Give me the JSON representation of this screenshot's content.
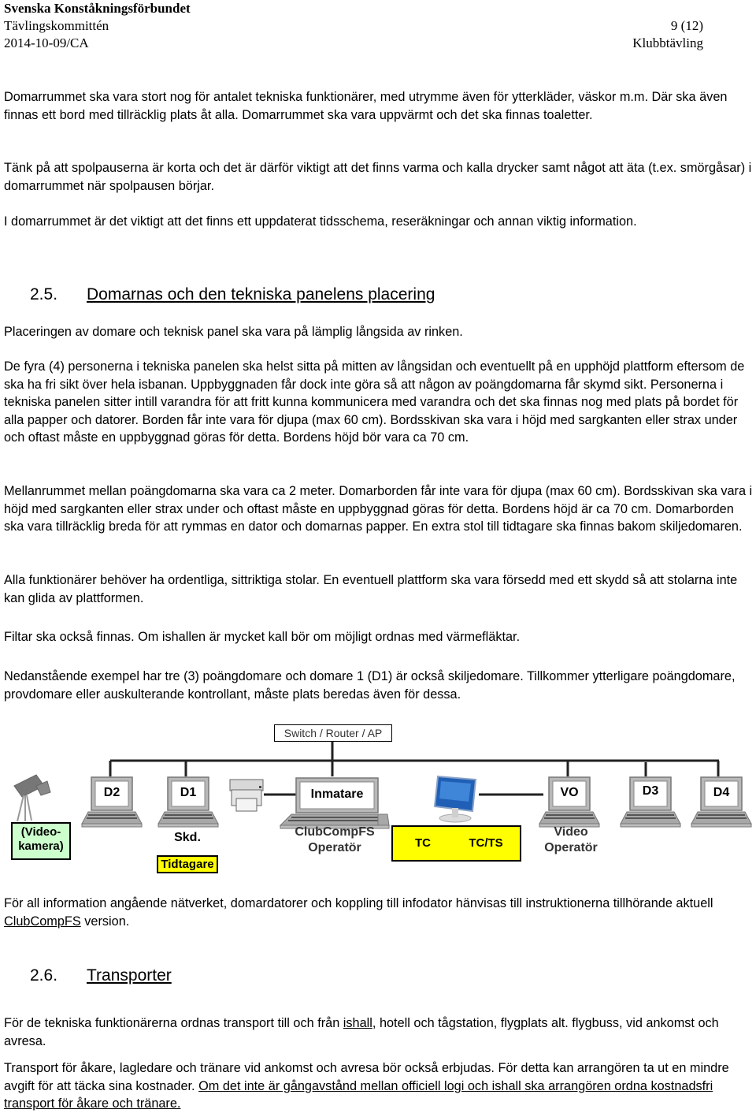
{
  "header": {
    "organization": "Svenska Konståkningsförbundet",
    "committee": "Tävlingskommittén",
    "page": "9 (12)",
    "date_ref": "2014-10-09/CA",
    "doc_type": "Klubbtävling"
  },
  "paragraphs": {
    "p1": "Domarrummet ska vara stort nog för antalet tekniska funktionärer, med utrymme även för ytterkläder, väskor m.m. Där ska även finnas ett bord med tillräcklig plats åt alla. Domarrummet ska vara uppvärmt och det ska finnas toaletter.",
    "p2": "Tänk på att spolpauserna är korta och det är därför viktigt att det finns varma och kalla drycker samt något att äta (t.ex. smörgåsar) i domarrummet när spolpausen börjar.",
    "p3": "I domarrummet är det viktigt att det finns ett uppdaterat tidsschema, reseräkningar och annan viktig information."
  },
  "section_2_5": {
    "number": "2.5.",
    "title": "Domarnas och den tekniska panelens placering",
    "p1": "Placeringen av domare och teknisk panel ska vara på lämplig långsida av rinken.",
    "p2": "De fyra (4) personerna i tekniska panelen ska helst sitta på mitten av långsidan och eventuellt på en upphöjd plattform eftersom de ska ha fri sikt över hela isbanan. Uppbyggnaden får dock inte göra så att någon av poängdomarna får skymd sikt. Personerna i tekniska panelen sitter intill varandra för att fritt kunna kommunicera med varandra och det ska finnas nog med plats på bordet för alla papper och datorer. Borden får inte vara för djupa (max 60 cm). Bordsskivan ska vara i höjd med sargkanten eller strax under och oftast måste en uppbyggnad göras för detta. Bordens höjd bör vara ca 70 cm.",
    "p3": "Mellanrummet mellan poängdomarna ska vara ca 2 meter. Domarborden får inte vara för djupa (max 60 cm). Bordsskivan ska vara i höjd med sargkanten eller strax under och oftast måste en uppbyggnad göras för detta. Bordens höjd är ca 70 cm. Domarborden ska vara tillräcklig breda för att rymmas en dator och domarnas papper. En extra stol till tidtagare ska finnas bakom skiljedomaren.",
    "p4": "Alla funktionärer behöver ha ordentliga, sittriktiga stolar. En eventuell plattform ska vara försedd med ett skydd så att stolarna inte kan glida av plattformen.",
    "p5": "Filtar ska också finnas. Om ishallen är mycket kall bör om möjligt ordnas med värmefläktar.",
    "p6": "Nedanstående exempel har tre (3) poängdomare och domare 1 (D1) är också skiljedomare. Tillkommer ytterligare poängdomare, provdomare eller auskulterande kontrollant, måste plats beredas även för dessa."
  },
  "diagram": {
    "switch_label": "Switch / Router / AP",
    "camera_label": "(Video-\nkamera)",
    "nodes": [
      {
        "id": "d2",
        "screen": "D2",
        "caption": ""
      },
      {
        "id": "d1",
        "screen": "D1",
        "caption": "Skd."
      },
      {
        "id": "inmatare",
        "screen": "Inmatare",
        "caption": "ClubCompFS Operatör"
      },
      {
        "id": "vo",
        "screen": "VO",
        "caption": "Video Operatör"
      },
      {
        "id": "d3",
        "screen": "D3",
        "caption": ""
      },
      {
        "id": "d4",
        "screen": "D4",
        "caption": ""
      }
    ],
    "tidtagare_label": "Tidtagare",
    "tc_label": "TC",
    "tcts_label": "TC/TS",
    "colors": {
      "green_box": "#ccffcc",
      "yellow_box": "#ffff00",
      "monitor_blue": "#1f5fb5"
    }
  },
  "after_diagram": {
    "text_before_link": "För all information angående nätverket, domardatorer och koppling till infodator hänvisas till instruktionerna tillhörande aktuell ",
    "link": "ClubCompFS",
    "text_after_link": " version."
  },
  "section_2_6": {
    "number": "2.6.",
    "title": "Transporter",
    "p1_before": "För de tekniska funktionärerna ordnas transport till och från ",
    "p1_link": "ishall",
    "p1_after": ", hotell och tågstation, flygplats alt. flygbuss, vid ankomst och avresa.",
    "p2_plain": "Transport för åkare, lagledare och tränare vid ankomst och avresa bör också erbjudas. För detta kan arrangören ta ut en mindre avgift för att täcka sina kostnader. ",
    "p2_underlined": "Om det inte är gångavstånd mellan officiell logi och ishall ska arrangören ordna kostnadsfri transport för åkare och tränare."
  }
}
